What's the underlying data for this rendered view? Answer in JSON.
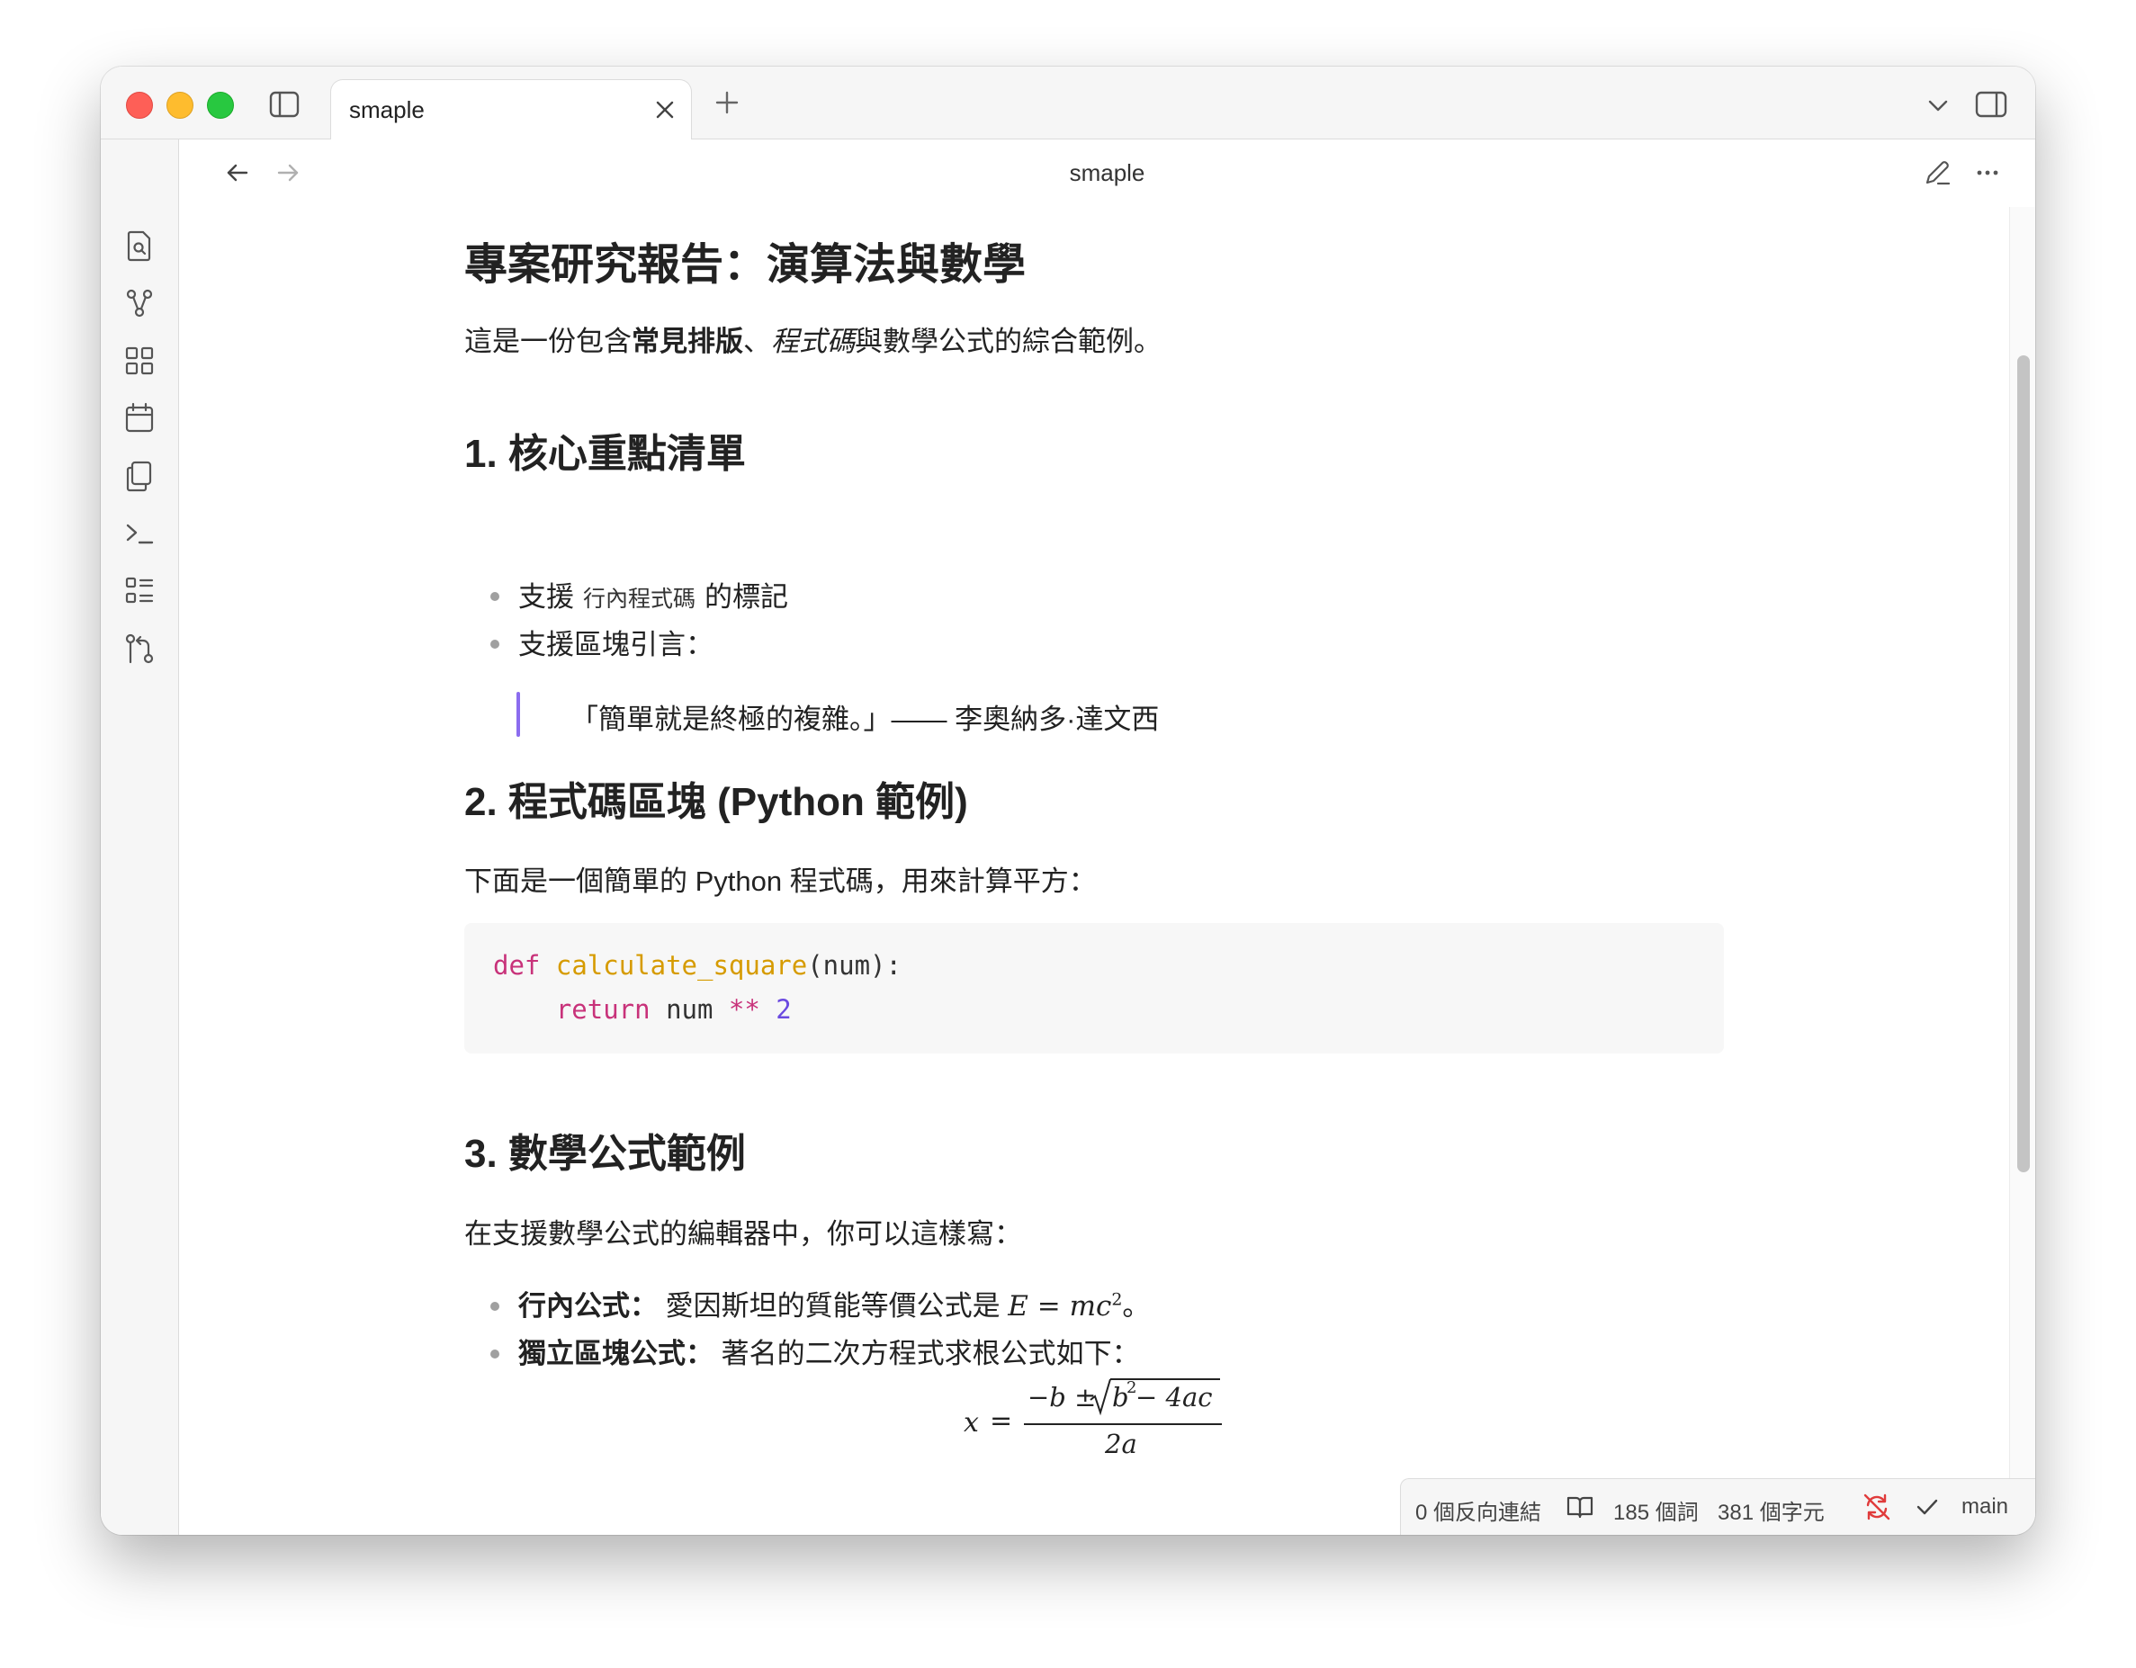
{
  "tab": {
    "title": "smaple"
  },
  "header": {
    "title": "smaple"
  },
  "doc": {
    "h1": "專案研究報告：演算法與數學",
    "intro": {
      "pre": "這是一份包含",
      "bold": "常見排版",
      "sep": "、",
      "italic": "程式碼",
      "post": "與數學公式的綜合範例。"
    },
    "section1": {
      "title": "1. 核心重點清單",
      "item1": {
        "pre": "支援",
        "code": "行內程式碼",
        "post": "的標記"
      },
      "item2": "支援區塊引言：",
      "quote": "「簡單就是終極的複雜。」—— 李奧納多·達文西"
    },
    "section2": {
      "title": "2. 程式碼區塊 (Python 範例)",
      "text": "下面是一個簡單的 Python 程式碼，用來計算平方：",
      "code": {
        "l1_def": "def",
        "l1_fn": "calculate_square",
        "l1_rest": "(num):",
        "l2_indent": "    ",
        "l2_ret": "return",
        "l2_var": " num ",
        "l2_op": "**",
        "l2_num": " 2"
      }
    },
    "section3": {
      "title": "3. 數學公式範例",
      "text": "在支援數學公式的編輯器中，你可以這樣寫：",
      "item1": {
        "label": "行內公式：",
        "text": " 愛因斯坦的質能等價公式是 ",
        "formula_E": "E",
        "formula_eq": " = ",
        "formula_mc": "mc",
        "formula_exp": "2",
        "post": "。"
      },
      "item2": {
        "label": "獨立區塊公式：",
        "text": " 著名的二次方程式求根公式如下："
      },
      "formula": {
        "x": "x",
        "eq": "=",
        "num_pre": "−b ± ",
        "sqrt_b": "b",
        "sqrt_exp": "2",
        "sqrt_rest": " − 4ac",
        "den": "2a"
      }
    }
  },
  "status": {
    "backlinks": "0 個反向連結",
    "words": "185 個詞",
    "chars": "381 個字元",
    "branch": "main"
  },
  "colors": {
    "accent": "#8b6cef",
    "sync_error": "#e03b3b"
  }
}
